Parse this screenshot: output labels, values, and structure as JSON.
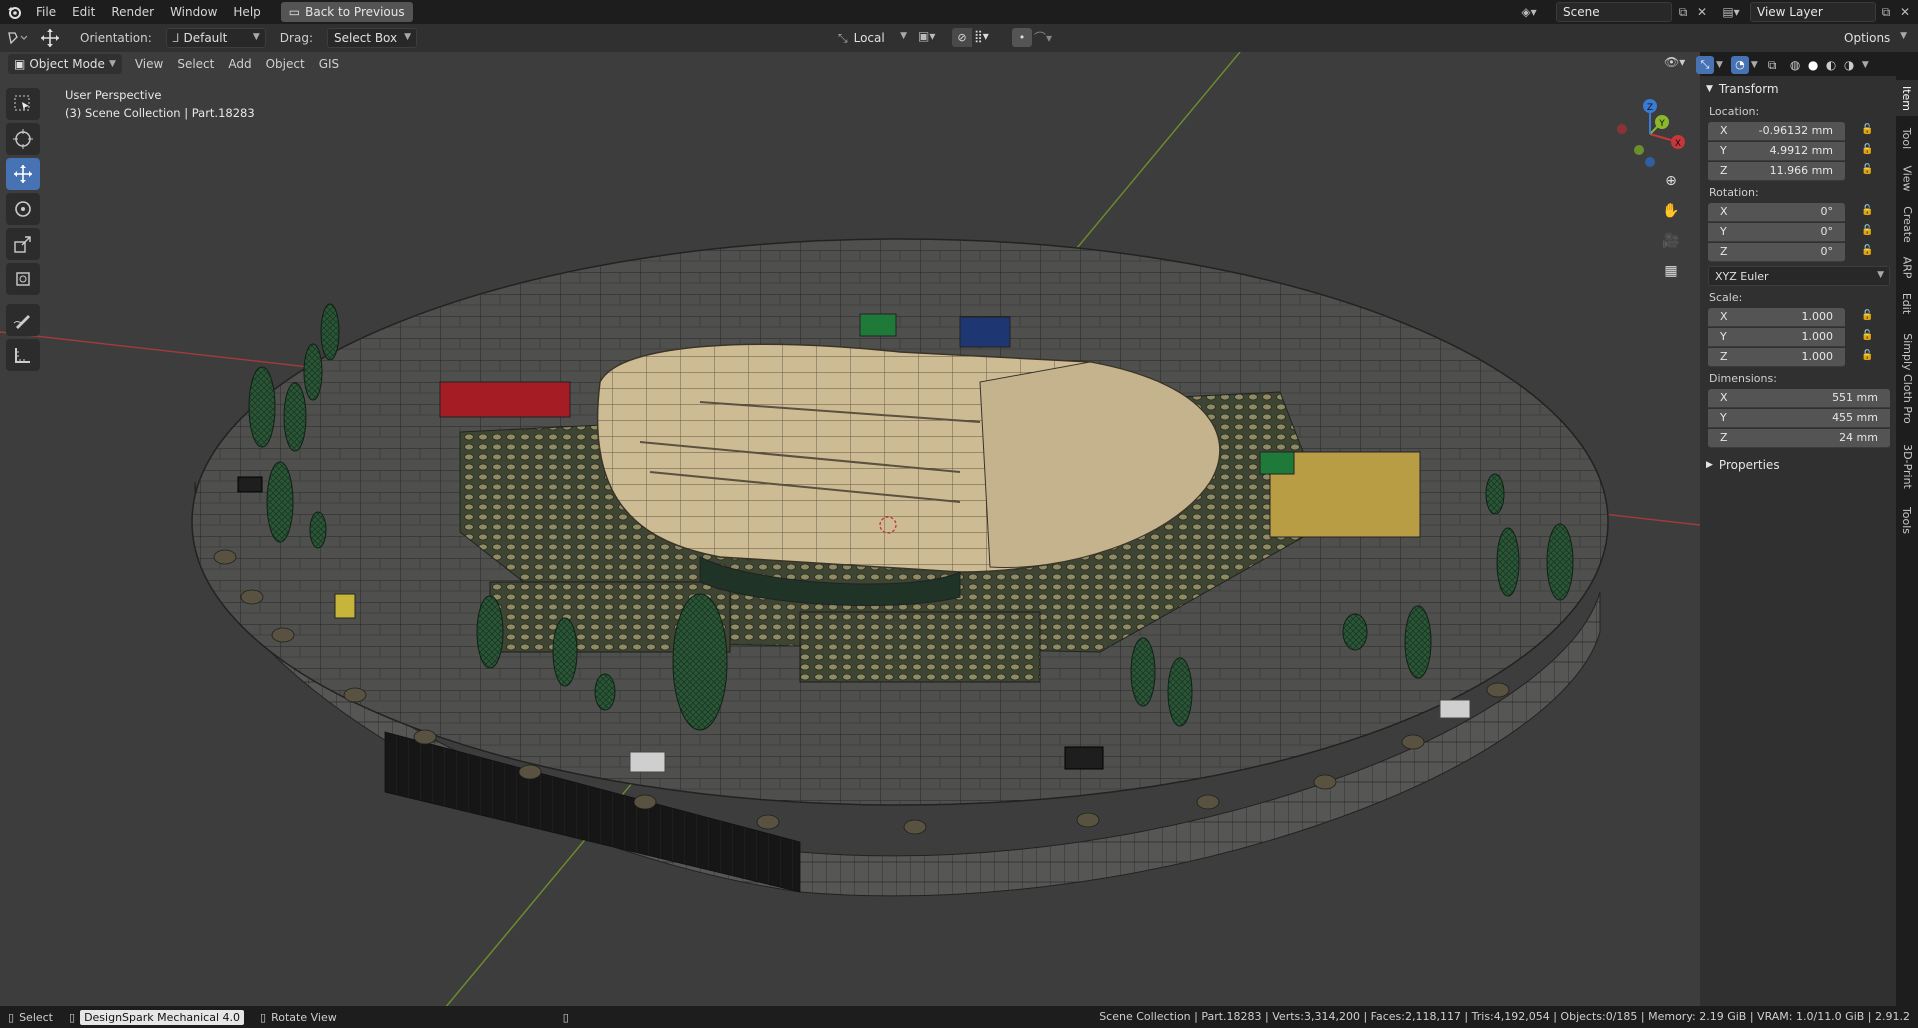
{
  "menubar": {
    "items": [
      "File",
      "Edit",
      "Render",
      "Window",
      "Help"
    ],
    "back_label": "Back to Previous",
    "scene": "Scene",
    "view_layer": "View Layer"
  },
  "toolbar": {
    "orientation_label": "Orientation:",
    "orientation_value": "Default",
    "drag_label": "Drag:",
    "drag_value": "Select Box",
    "pivot_value": "Local",
    "options_label": "Options"
  },
  "viewport_header": {
    "mode": "Object Mode",
    "menus": [
      "View",
      "Select",
      "Add",
      "Object",
      "GIS"
    ]
  },
  "viewport": {
    "perspective": "User Perspective",
    "collection": "(3) Scene Collection | Part.18283"
  },
  "gizmo": {
    "x": "X",
    "y": "Y",
    "z": "Z"
  },
  "sidebar": {
    "transform_title": "Transform",
    "location_label": "Location:",
    "location": [
      {
        "axis": "X",
        "value": "-0.96132 mm"
      },
      {
        "axis": "Y",
        "value": "4.9912 mm"
      },
      {
        "axis": "Z",
        "value": "11.966 mm"
      }
    ],
    "rotation_label": "Rotation:",
    "rotation": [
      {
        "axis": "X",
        "value": "0°"
      },
      {
        "axis": "Y",
        "value": "0°"
      },
      {
        "axis": "Z",
        "value": "0°"
      }
    ],
    "rotation_mode": "XYZ Euler",
    "scale_label": "Scale:",
    "scale": [
      {
        "axis": "X",
        "value": "1.000"
      },
      {
        "axis": "Y",
        "value": "1.000"
      },
      {
        "axis": "Z",
        "value": "1.000"
      }
    ],
    "dimensions_label": "Dimensions:",
    "dimensions": [
      {
        "axis": "X",
        "value": "551 mm"
      },
      {
        "axis": "Y",
        "value": "455 mm"
      },
      {
        "axis": "Z",
        "value": "24 mm"
      }
    ],
    "properties_title": "Properties"
  },
  "tabs": [
    "Item",
    "Tool",
    "View",
    "Create",
    "ARP",
    "Edit",
    "Simply Cloth Pro",
    "3D-Print",
    "Tools"
  ],
  "statusbar": {
    "select": "Select",
    "app": "DesignSpark Mechanical 4.0",
    "rotate": "Rotate View",
    "stats": "Scene Collection | Part.18283 | Verts:3,314,200 | Faces:2,118,117 | Tris:4,192,054 | Objects:0/185 | Memory: 2.19 GiB | VRAM: 1.0/11.0 GiB | 2.91.2"
  },
  "colors": {
    "accent": "#4772b3",
    "axis_x": "#c8353a",
    "axis_y": "#8bb82d",
    "axis_z": "#3a7bd5"
  }
}
